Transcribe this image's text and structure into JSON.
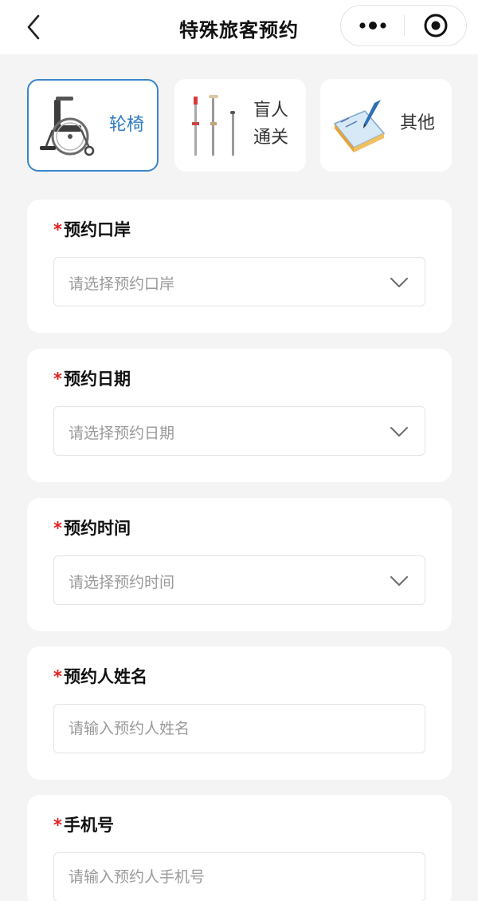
{
  "navbar": {
    "title": "特殊旅客预约",
    "back_icon": "chevron-left-icon",
    "more_icon": "more-dots-icon",
    "close_icon": "target-close-icon"
  },
  "service_types": [
    {
      "label": "轮椅",
      "icon": "wheelchair-icon",
      "selected": true
    },
    {
      "label_line1": "盲人",
      "label_line2": "通关",
      "icon": "crutches-icon",
      "selected": false
    },
    {
      "label": "其他",
      "icon": "notepad-pen-icon",
      "selected": false
    }
  ],
  "form": {
    "port": {
      "required_mark": "*",
      "label": "预约口岸",
      "placeholder": "请选择预约口岸"
    },
    "date": {
      "required_mark": "*",
      "label": "预约日期",
      "placeholder": "请选择预约日期"
    },
    "time": {
      "required_mark": "*",
      "label": "预约时间",
      "placeholder": "请选择预约时间"
    },
    "name": {
      "required_mark": "*",
      "label": "预约人姓名",
      "placeholder": "请输入预约人姓名",
      "value": ""
    },
    "phone": {
      "required_mark": "*",
      "label": "手机号",
      "placeholder": "请输入预约人手机号",
      "value": ""
    }
  },
  "colors": {
    "accent": "#2f7cc1",
    "required": "#e02020",
    "background": "#f4f4f5",
    "placeholder": "#9a9a9a"
  }
}
